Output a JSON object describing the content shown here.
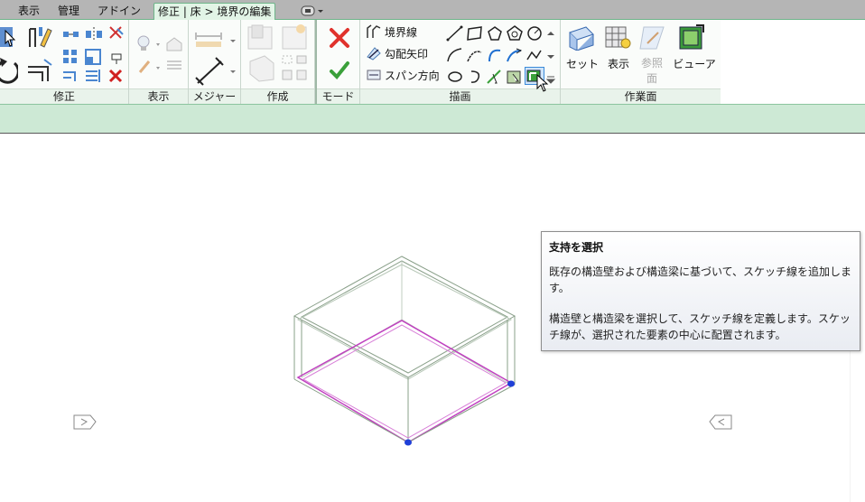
{
  "tabs": [
    {
      "label": "表示",
      "active": false
    },
    {
      "label": "管理",
      "active": false
    },
    {
      "label": "アドイン",
      "active": false
    },
    {
      "label": "修正 | 床 > 境界の編集",
      "active": true
    }
  ],
  "panels": {
    "modify": {
      "label": "修正"
    },
    "view": {
      "label": "表示"
    },
    "measure": {
      "label": "メジャー"
    },
    "create": {
      "label": "作成"
    },
    "mode": {
      "label": "モード"
    },
    "draw": {
      "label": "描画",
      "boundary_line": "境界線",
      "slope_arrow": "勾配矢印",
      "span_direction": "スパン方向"
    },
    "work_plane": {
      "label": "作業面",
      "set": "セット",
      "show": "表示",
      "ref_plane": "参照面",
      "viewer": "ビューア"
    }
  },
  "tooltip": {
    "title": "支持を選択",
    "para1": "既存の構造壁および構造梁に基づいて、スケッチ線を追加します。",
    "para2": "構造壁と構造梁を選択して、スケッチ線を定義します。スケッチ線が、選択された要素の中心に配置されます。"
  },
  "colors": {
    "ribbon_bg": "#fafcfa",
    "accent_green": "#6fb48a",
    "sketch_magenta": "#c040c0",
    "cancel_red": "#e0322c",
    "finish_green": "#3aa03a"
  }
}
